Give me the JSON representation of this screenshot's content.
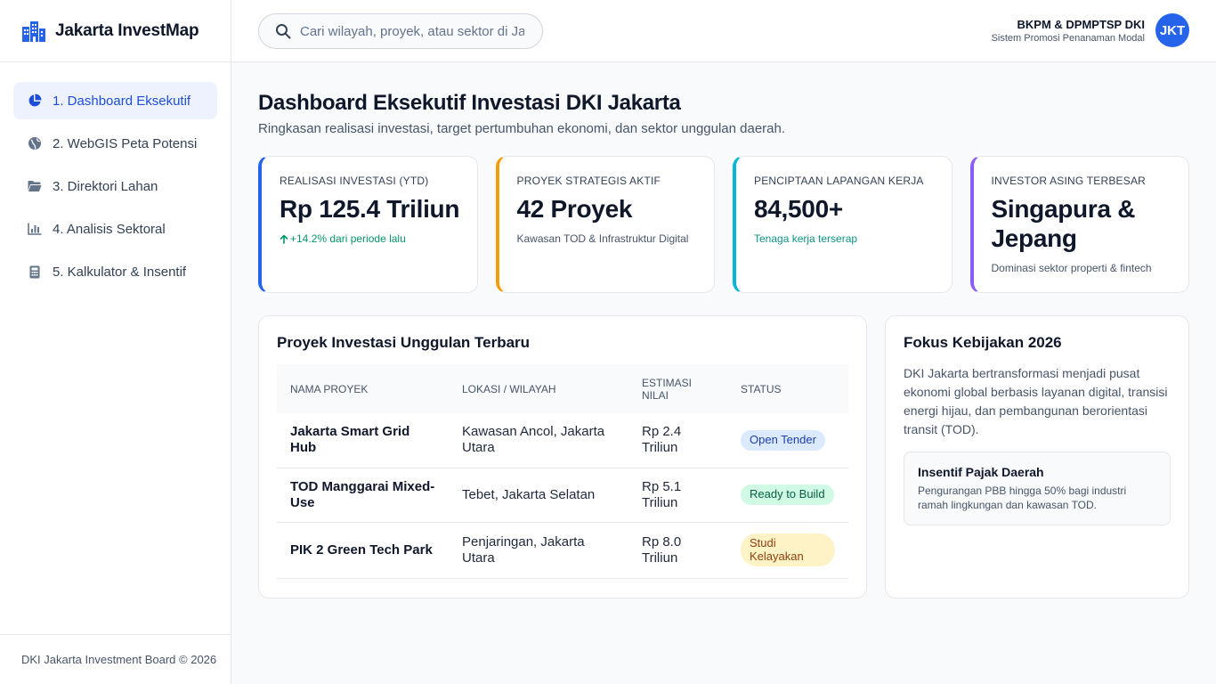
{
  "app": {
    "name": "Jakarta InvestMap",
    "brand_color": "#2563eb"
  },
  "sidebar": {
    "items": [
      {
        "label": "1. Dashboard Eksekutif",
        "icon": "pie-chart-icon",
        "active": true
      },
      {
        "label": "2. WebGIS Peta Potensi",
        "icon": "globe-icon",
        "active": false
      },
      {
        "label": "3. Direktori Lahan",
        "icon": "folder-icon",
        "active": false
      },
      {
        "label": "4. Analisis Sektoral",
        "icon": "bar-chart-icon",
        "active": false
      },
      {
        "label": "5. Kalkulator & Insentif",
        "icon": "calculator-icon",
        "active": false
      }
    ],
    "footer": "DKI Jakarta Investment Board © 2026"
  },
  "header": {
    "search_placeholder": "Cari wilayah, proyek, atau sektor di Jakarta...",
    "org": "BKPM & DPMPTSP DKI",
    "org_sub": "Sistem Promosi Penanaman Modal",
    "avatar": "JKT"
  },
  "main": {
    "title": "Dashboard Eksekutif Investasi DKI Jakarta",
    "subtitle": "Ringkasan realisasi investasi, target pertumbuhan ekonomi, dan sektor unggulan daerah."
  },
  "kpis": [
    {
      "label": "Realisasi Investasi (YTD)",
      "value": "Rp 125.4 Triliun",
      "note": "+14.2% dari periode lalu",
      "accent": "#2563eb"
    },
    {
      "label": "Proyek Strategis Aktif",
      "value": "42 Proyek",
      "note": "Kawasan TOD & Infrastruktur Digital",
      "accent": "#f59e0b"
    },
    {
      "label": "Penciptaan Lapangan Kerja",
      "value": "84,500+",
      "note": "Tenaga kerja terserap",
      "accent": "#06b6d4"
    },
    {
      "label": "Investor Asing Terbesar",
      "value": "Singapura & Jepang",
      "note": "Dominasi sektor properti & fintech",
      "accent": "#8b5cf6"
    }
  ],
  "projects": {
    "title": "Proyek Investasi Unggulan Terbaru",
    "columns": [
      "Nama Proyek",
      "Lokasi / Wilayah",
      "Estimasi Nilai",
      "Status"
    ],
    "rows": [
      {
        "name": "Jakarta Smart Grid Hub",
        "location": "Kawasan Ancol, Jakarta Utara",
        "value": "Rp 2.4 Triliun",
        "status": "Open Tender"
      },
      {
        "name": "TOD Manggarai Mixed-Use",
        "location": "Tebet, Jakarta Selatan",
        "value": "Rp 5.1 Triliun",
        "status": "Ready to Build"
      },
      {
        "name": "PIK 2 Green Tech Park",
        "location": "Penjaringan, Jakarta Utara",
        "value": "Rp 8.0 Triliun",
        "status": "Studi Kelayakan"
      }
    ]
  },
  "policy": {
    "title": "Fokus Kebijakan 2026",
    "text": "DKI Jakarta bertransformasi menjadi pusat ekonomi global berbasis layanan digital, transisi energi hijau, dan pembangunan berorientasi transit (TOD).",
    "incentive_title": "Insentif Pajak Daerah",
    "incentive_text": "Pengurangan PBB hingga 50% bagi industri ramah lingkungan dan kawasan TOD."
  }
}
